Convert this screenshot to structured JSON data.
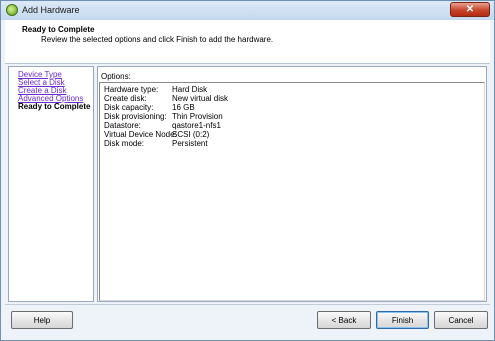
{
  "window": {
    "title": "Add Hardware",
    "close_glyph": "✕"
  },
  "header": {
    "title": "Ready to Complete",
    "subtitle": "Review the selected options and click Finish to add the hardware."
  },
  "nav": {
    "items": [
      {
        "label": "Device Type"
      },
      {
        "label": "Select a Disk"
      },
      {
        "label": "Create a Disk"
      },
      {
        "label": "Advanced Options"
      },
      {
        "label": "Ready to Complete"
      }
    ]
  },
  "options": {
    "label": "Options:",
    "rows": [
      {
        "key": "Hardware type:",
        "value": "Hard Disk"
      },
      {
        "key": "Create disk:",
        "value": "New virtual disk"
      },
      {
        "key": "Disk capacity:",
        "value": "16 GB"
      },
      {
        "key": "Disk provisioning:",
        "value": "Thin Provision"
      },
      {
        "key": "Datastore:",
        "value": "qastore1-nfs1"
      },
      {
        "key": "Virtual Device Node:",
        "value": "SCSI (0:2)"
      },
      {
        "key": "Disk mode:",
        "value": "Persistent"
      }
    ]
  },
  "buttons": {
    "help": "Help",
    "back": "< Back",
    "finish": "Finish",
    "cancel": "Cancel"
  }
}
